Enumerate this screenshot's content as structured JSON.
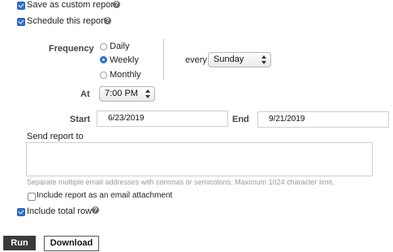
{
  "options": {
    "save_custom_label": "Save as custom report",
    "schedule_label": "Schedule this report",
    "include_total_label": "Include total row",
    "save_custom_checked": true,
    "schedule_checked": true,
    "include_total_checked": true
  },
  "frequency": {
    "label": "Frequency",
    "options": [
      "Daily",
      "Weekly",
      "Monthly"
    ],
    "selected": "Weekly",
    "every_label": "every",
    "day_value": "Sunday"
  },
  "at": {
    "label": "At",
    "time_value": "7:00 PM"
  },
  "dates": {
    "start_label": "Start",
    "start_value": "6/23/2019",
    "end_label": "End",
    "end_value": "9/21/2019"
  },
  "send": {
    "label": "Send report to",
    "value": "",
    "hint": "Separate multiple email addresses with commas or semicolons. Maximum 1024 character limit.",
    "attachment_label": "Include report as an email attachment",
    "attachment_checked": false
  },
  "buttons": {
    "run": "Run",
    "download": "Download"
  },
  "colors": {
    "accent": "#2f6fcf",
    "run_bg": "#3a3a3a"
  }
}
